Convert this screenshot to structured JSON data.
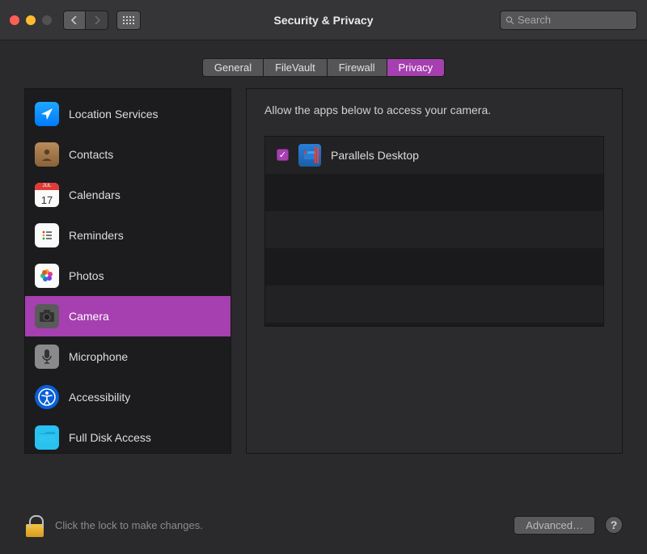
{
  "window": {
    "title": "Security & Privacy"
  },
  "search": {
    "placeholder": "Search"
  },
  "tabs": [
    {
      "label": "General",
      "active": false
    },
    {
      "label": "FileVault",
      "active": false
    },
    {
      "label": "Firewall",
      "active": false
    },
    {
      "label": "Privacy",
      "active": true
    }
  ],
  "sidebar": {
    "items": [
      {
        "label": "Location Services",
        "icon": "location"
      },
      {
        "label": "Contacts",
        "icon": "contacts"
      },
      {
        "label": "Calendars",
        "icon": "calendars",
        "day": "17",
        "month": "JUL"
      },
      {
        "label": "Reminders",
        "icon": "reminders"
      },
      {
        "label": "Photos",
        "icon": "photos"
      },
      {
        "label": "Camera",
        "icon": "camera",
        "selected": true
      },
      {
        "label": "Microphone",
        "icon": "microphone"
      },
      {
        "label": "Accessibility",
        "icon": "accessibility"
      },
      {
        "label": "Full Disk Access",
        "icon": "fulldisk"
      }
    ]
  },
  "panel": {
    "description": "Allow the apps below to access your camera.",
    "apps": [
      {
        "name": "Parallels Desktop",
        "checked": true
      }
    ]
  },
  "footer": {
    "lock_text": "Click the lock to make changes.",
    "advanced": "Advanced…"
  }
}
